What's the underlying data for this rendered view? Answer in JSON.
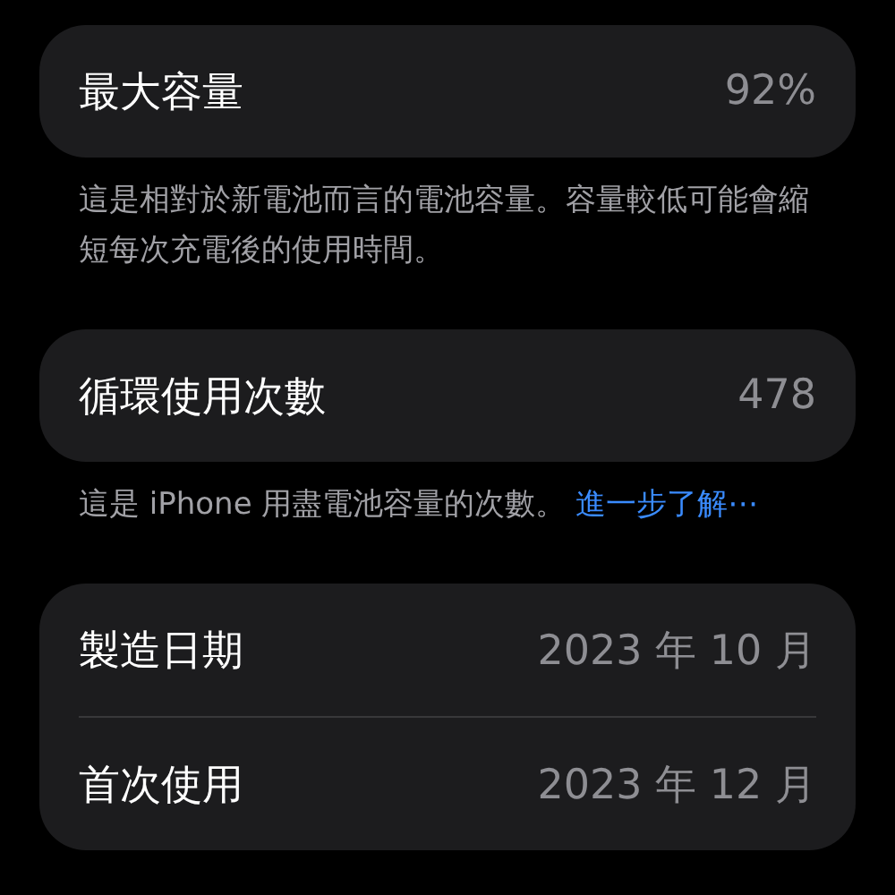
{
  "sections": [
    {
      "rows": [
        {
          "label": "最大容量",
          "value": "92%"
        }
      ],
      "footer": {
        "text": "這是相對於新電池而言的電池容量。容量較低可能會縮短每次充電後的使用時間。"
      }
    },
    {
      "rows": [
        {
          "label": "循環使用次數",
          "value": "478"
        }
      ],
      "footer": {
        "text": "這是 iPhone 用盡電池容量的次數。",
        "link": "進一步了解⋯"
      }
    },
    {
      "rows": [
        {
          "label": "製造日期",
          "value": "2023 年 10 月"
        },
        {
          "label": "首次使用",
          "value": "2023 年 12 月"
        }
      ]
    }
  ]
}
